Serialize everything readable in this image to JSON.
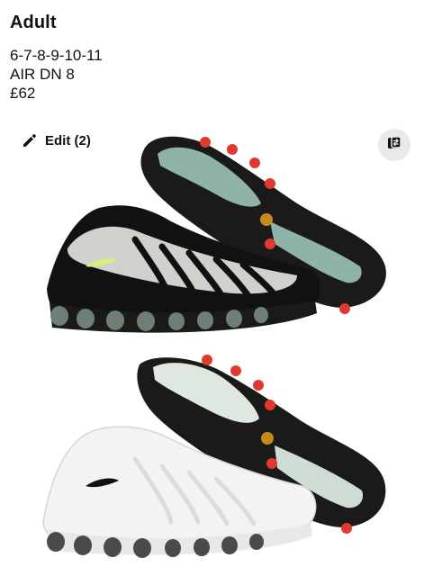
{
  "product": {
    "title": "Adult",
    "sizes": "6-7-8-9-10-11",
    "model": "AIR DN 8",
    "price": "£62"
  },
  "image_toolbar": {
    "edit_label": "Edit (2)",
    "edit_icon": "pencil-icon",
    "swap_icon": "swap-images-icon"
  },
  "photos": [
    {
      "colorway": "black"
    },
    {
      "colorway": "white"
    }
  ]
}
